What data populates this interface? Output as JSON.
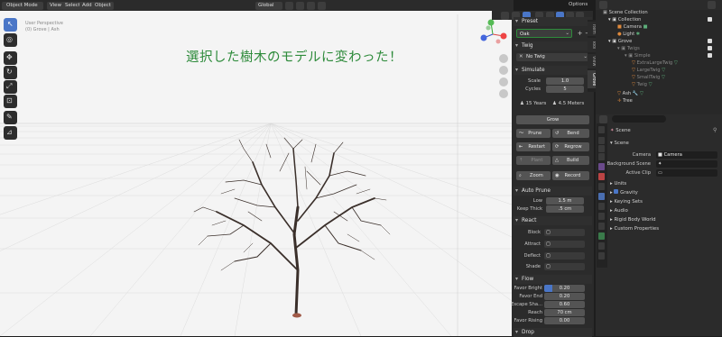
{
  "viewport": {
    "header": {
      "mode": "Object Mode",
      "menus": [
        "View",
        "Select",
        "Add",
        "Object"
      ],
      "orientation": "Global",
      "options": "Options"
    },
    "overlay_info": [
      "User Perspective",
      "(0) Grove | Ash"
    ],
    "annotation": "選択した樹木のモデルに変わった！",
    "tabs": [
      "Item",
      "Tool",
      "View",
      "Grove"
    ],
    "accent": "#2e8b3b"
  },
  "grove_panel": {
    "preset": {
      "header": "Preset",
      "value": "Oak"
    },
    "twig": {
      "header": "Twig",
      "value": "No Twig"
    },
    "simulate": {
      "header": "Simulate",
      "scale_label": "Scale",
      "scale_value": "1.0",
      "cycles_label": "Cycles",
      "cycles_value": "5",
      "years": "15 Years",
      "meters": "4.5 Meters",
      "grow": "Grow",
      "prune": "Prune",
      "bend": "Bend",
      "restart": "Restart",
      "regrow": "Regrow",
      "plant": "Plant",
      "build": "Build",
      "zoom": "Zoom",
      "record": "Record"
    },
    "auto_prune": {
      "header": "Auto Prune",
      "low_label": "Low",
      "low_value": "1.5 m",
      "keep_label": "Keep Thick",
      "keep_value": ".5 cm"
    },
    "react": {
      "header": "React",
      "items": [
        "Block",
        "Attract",
        "Deflect",
        "Shade"
      ]
    },
    "flow": {
      "header": "Flow",
      "rows": [
        {
          "label": "Favor Bright",
          "value": "0.20"
        },
        {
          "label": "Favor End",
          "value": "0.20"
        },
        {
          "label": "Escape Sha...",
          "value": "0.60"
        },
        {
          "label": "Reach",
          "value": "70 cm"
        },
        {
          "label": "Favor Rising",
          "value": "0.00"
        }
      ]
    },
    "drop": {
      "header": "Drop"
    }
  },
  "outliner": {
    "items": [
      {
        "label": "Scene Collection",
        "indent": 0
      },
      {
        "label": "Collection",
        "indent": 1
      },
      {
        "label": "Camera",
        "indent": 2
      },
      {
        "label": "Light",
        "indent": 2
      },
      {
        "label": "Grove",
        "indent": 1
      },
      {
        "label": "Twigs",
        "indent": 2
      },
      {
        "label": "Simple",
        "indent": 3
      },
      {
        "label": "ExtraLargeTwig",
        "indent": 4
      },
      {
        "label": "LargeTwig",
        "indent": 4
      },
      {
        "label": "SmallTwig",
        "indent": 4
      },
      {
        "label": "Twig",
        "indent": 4
      },
      {
        "label": "Ash",
        "indent": 2
      },
      {
        "label": "Tree",
        "indent": 2
      }
    ]
  },
  "properties": {
    "breadcrumb": "Scene",
    "scene_header": "Scene",
    "camera_label": "Camera",
    "camera_value": "Camera",
    "bg_label": "Background Scene",
    "clip_label": "Active Clip",
    "sections": [
      "Units",
      "Gravity",
      "Keying Sets",
      "Audio",
      "Rigid Body World",
      "Custom Properties"
    ]
  }
}
